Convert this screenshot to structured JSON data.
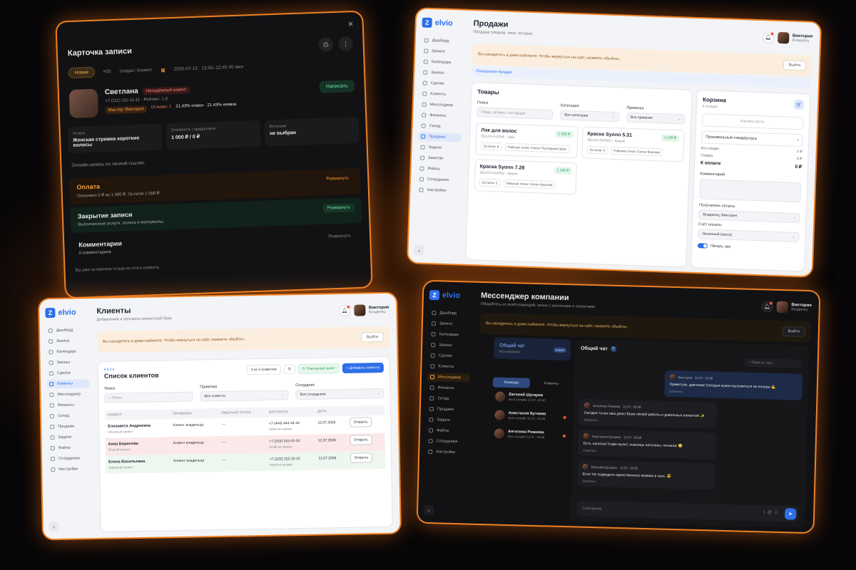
{
  "record": {
    "title": "Карточка записи",
    "status": "Новая",
    "number": "#20",
    "creator": "создал: Клиент",
    "datetime": "2026-07-13 · 12:00–12:45 45 мин",
    "client_name": "Светлана",
    "client_tag": "Ненадёжный клиент",
    "phone": "+7 (111) 111-11-11",
    "rating": "Рейтинг: 1.0",
    "master": "Мастер: Виктория",
    "reviews": "Отзывы: 1",
    "stats": "21.43% отмен · 21.43% неявок",
    "write_label": "Написать",
    "services_label": "Услуги",
    "services_value": "Женская стрижка короткие волосы",
    "cost_label": "Стоимость / предоплата",
    "cost_value": "1 000 ₽ / 0 ₽",
    "source_label": "Источник",
    "source_value": "не выбран",
    "online_note": "Онлайн-запись по личной ссылке.",
    "expand_label": "Развернуть",
    "payment_title": "Оплата",
    "payment_text": "Оплачено 0 ₽ из 1 000 ₽. Остаток 1 000 ₽.",
    "closing_title": "Закрытие записи",
    "closing_text": "Выполненные услуги, оплата и материалы.",
    "comments_title": "Комментарии",
    "comments_count": "0 комментариев",
    "review_note": "Вы уже оставляли отзыв на этого клиента."
  },
  "app": {
    "brand": "elvio",
    "user_name": "Виктория",
    "user_role": "Владелец",
    "demo_text": "Вы находитесь в демо-кабинете. Чтобы вернуться на сайт, нажмите «Выйти».",
    "exit_label": "Выйти",
    "nav": [
      "Дашборд",
      "Записи",
      "Календарь",
      "Заказы",
      "Сделки",
      "Клиенты",
      "Мессенджер",
      "Финансы",
      "Склад",
      "Продажи",
      "Задачи",
      "Заметки",
      "Файлы",
      "Сотрудники",
      "Настройки"
    ]
  },
  "sales": {
    "title": "Продажи",
    "subtitle": "Продажа товаров, чеки, история",
    "show_sales": "Показатели продаж",
    "goods_title": "Товары",
    "search_label": "Поиск",
    "search_placeholder": "Товар, артикул, поставщик",
    "category_label": "Категория",
    "category_value": "Все категории",
    "binding_label": "Привязка",
    "binding_value": "Все привязки",
    "products": [
      {
        "name": "Лак для волос",
        "sku": "ZELVIO-PJ20NF · Лаки",
        "price": "1 200 ₽",
        "stock": "Остатки: 8",
        "point": "Рабочая точка: Салон Последний Шанс"
      },
      {
        "name": "Краска Syonn 7.28",
        "sku": "ZELVIO-ZAXFBU · Краски",
        "price": "1 100 ₽",
        "stock": "Остатки: 2",
        "point": "Рабочая точка: Салон Красова"
      },
      {
        "name": "Краска Syonn 5.31",
        "sku": "ZELVIO-ZGP5GJ · Краски",
        "price": "1 100 ₽",
        "stock": "Остатки: 4",
        "point": "Рабочая точка: Салон Красова"
      }
    ],
    "cart_title": "Корзина",
    "cart_positions": "0 позиций",
    "cart_empty": "Корзина пуста.",
    "arbitrary": "Произвольный товар/услуга",
    "no_discount": "Без скидки",
    "discount": "Скидка",
    "to_pay": "К оплате",
    "zero": "0 ₽",
    "comment_label": "Комментарий",
    "payee_label": "Получатель оплаты",
    "payee_value": "Владелец: Виктория",
    "account_label": "Счёт оплаты",
    "account_value": "Наличный (касса)",
    "print_label": "Печать чек"
  },
  "clients": {
    "title": "Клиенты",
    "subtitle": "Добавление и просмотр клиентской базы",
    "base": "БАЗА",
    "list_title": "Список клиентов",
    "count": "3 из 3 клиентов",
    "repeat_label": "Повторный визит",
    "add_label": "Добавить клиента",
    "search_label": "Поиск",
    "search_placeholder": "Поиск...",
    "binding_label": "Привязка",
    "binding_value": "Все клиенты",
    "staff_label": "Сотрудник",
    "staff_value": "Все сотрудники",
    "columns": [
      "КЛИЕНТ",
      "ПРИВЯЗКА",
      "РАБОЧАЯ ТОЧКА",
      "КОНТАКТЫ",
      "ДАТА"
    ],
    "rows": [
      {
        "name": "Елизавета Андреевна",
        "type": "Обычный клиент",
        "binding": "Клиент владельца",
        "point": "—",
        "phone": "+7 (444) 444-44-44",
        "email": "email не указан",
        "date": "12.07.2026"
      },
      {
        "name": "Анна Борисова",
        "type": "Плохой клиент",
        "binding": "Клиент владельца",
        "point": "—",
        "phone": "+7 (333) 333-33-33",
        "email": "email не указан",
        "date": "12.07.2026"
      },
      {
        "name": "Елена Васильевна",
        "type": "Хороший клиент",
        "binding": "Клиент владельца",
        "point": "—",
        "phone": "+7 (222) 222-22-22",
        "email": "email не указан",
        "date": "12.07.2026"
      }
    ],
    "open_label": "Открыть"
  },
  "messenger": {
    "title": "Мессенджер компании",
    "subtitle": "Общайтесь со всей командой, лично с коллегами и клиентами.",
    "general_chat": "Общий чат",
    "general_sub": "Вся компания",
    "new_badge": "новое",
    "tab_team": "Команда",
    "tab_clients": "Клиенты",
    "contacts": [
      {
        "name": "Евгений Шугарев",
        "seen": "Был онлайн 12.07, 18:40"
      },
      {
        "name": "Анастасия Бутаева",
        "seen": "Был онлайн 12.07, 18:39"
      },
      {
        "name": "Ангелина Рожкова",
        "seen": "Был онлайн 12.07, 18:38"
      }
    ],
    "chat_title": "Общий чат",
    "chat_search": "Поиск по чату",
    "messages": [
      {
        "author": "Виктория",
        "time": "12.07, 18:38",
        "text": "Приветули, девчонки! Сегодня нужно выложиться на полную 💪",
        "reply": "Ответить"
      },
      {
        "author": "Ангелина Рожкова",
        "time": "12.07, 18:38",
        "text": "Сегодня точно наш день! Всем лёгкой работы и довольных клиентов! ✨",
        "reply": "Ответить"
      },
      {
        "author": "Анастасия Бутаева",
        "time": "12.07, 18:38",
        "text": "Есть, капитан! Кофе выпит, ножницы наточены, погнали! 😊",
        "reply": "Ответить"
      },
      {
        "author": "Евгений Шугарев",
        "time": "12.07, 18:39",
        "text": "Есть! Не подведите единственного мужика в чате. 😎",
        "reply": "Ответить"
      }
    ],
    "compose_placeholder": "Сообщение"
  }
}
